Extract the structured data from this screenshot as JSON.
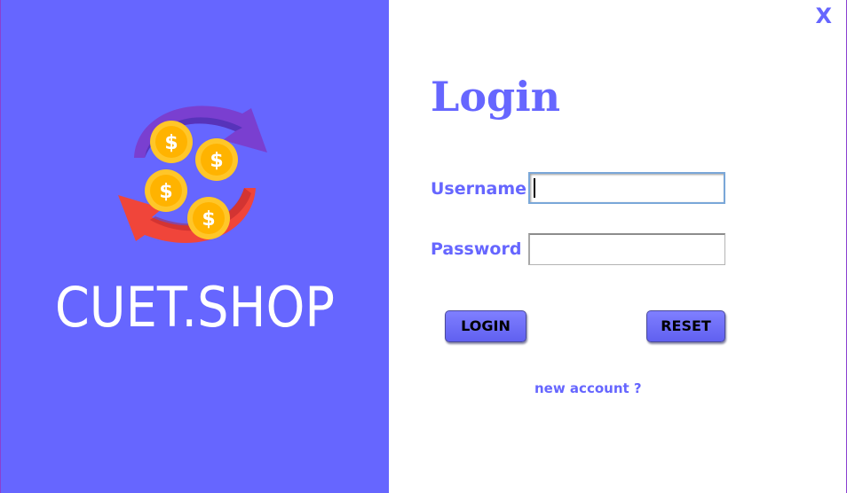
{
  "brand": {
    "name": "CUET.SHOP",
    "logo_icon": "currency-exchange-coins-icon"
  },
  "window": {
    "close_label": "X"
  },
  "form": {
    "title": "Login",
    "username_label": "Username",
    "username_value": "",
    "password_label": "Password",
    "password_value": "",
    "login_button": "LOGIN",
    "reset_button": "RESET",
    "new_account_link": "new account ?"
  },
  "colors": {
    "accent": "#6666ff",
    "arrow_purple": "#7a3fd0",
    "arrow_red": "#f0453a",
    "coin": "#ffc629",
    "background": "#ffffff"
  }
}
